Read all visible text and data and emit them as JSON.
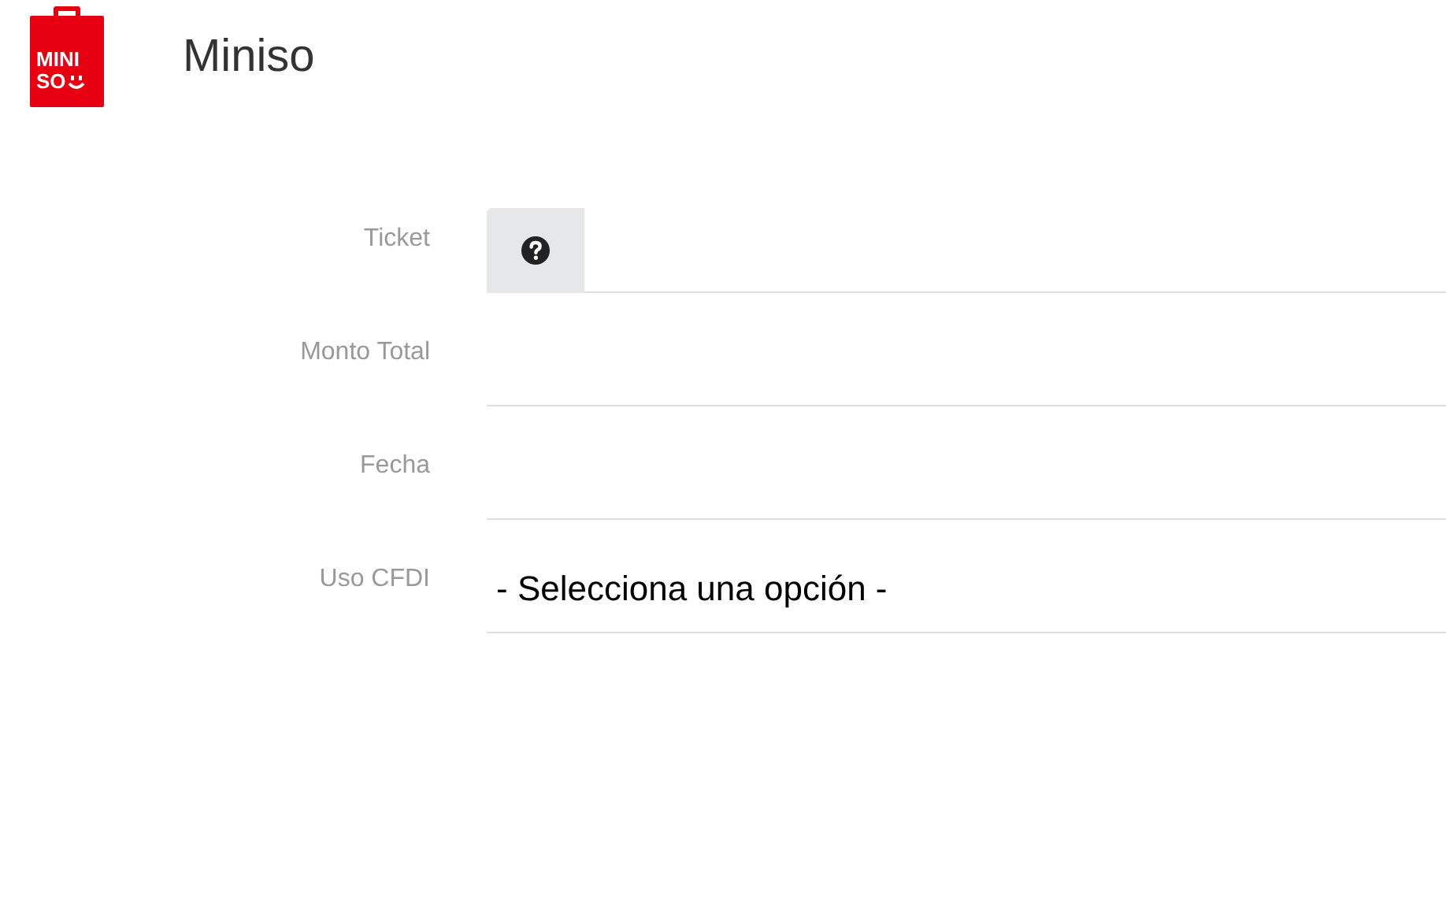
{
  "brand": {
    "logo_lines": [
      "MINI",
      "SO"
    ],
    "title": "Miniso"
  },
  "fields": [
    {
      "label": "Ticket",
      "kind": "text",
      "help": true
    },
    {
      "label": "Monto Total",
      "kind": "text"
    },
    {
      "label": "Fecha",
      "kind": "text"
    },
    {
      "label": "Uso CFDI",
      "kind": "select",
      "value": "- Selecciona una opción -"
    }
  ]
}
